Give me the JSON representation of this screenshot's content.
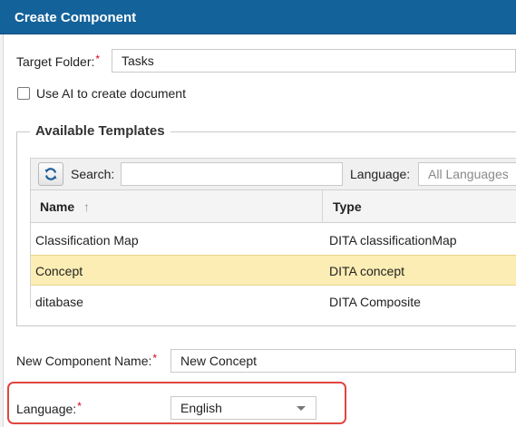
{
  "dialog": {
    "title": "Create Component"
  },
  "target_folder": {
    "label": "Target Folder:",
    "required_mark": "*",
    "value": "Tasks"
  },
  "ai_option": {
    "label": "Use AI to create document",
    "checked": false
  },
  "templates": {
    "legend": "Available Templates",
    "search_label": "Search:",
    "search_value": "",
    "language_label": "Language:",
    "language_placeholder": "All Languages",
    "columns": {
      "name": "Name",
      "type": "Type",
      "sort_indicator": "↑"
    },
    "rows": [
      {
        "name": "Classification Map",
        "type": "DITA classificationMap",
        "selected": false
      },
      {
        "name": "Concept",
        "type": "DITA concept",
        "selected": true
      },
      {
        "name": "ditabase",
        "type": "DITA Composite",
        "selected": false
      }
    ],
    "icons": {
      "refresh": "refresh-icon"
    }
  },
  "component_name": {
    "label": "New Component Name:",
    "required_mark": "*",
    "value": "New Concept"
  },
  "language": {
    "label": "Language:",
    "required_mark": "*",
    "value": "English"
  },
  "colors": {
    "title_bar": "#14629a",
    "selected_row": "#fcedb4",
    "required": "#d0021b",
    "highlight_border": "#e0463f"
  }
}
